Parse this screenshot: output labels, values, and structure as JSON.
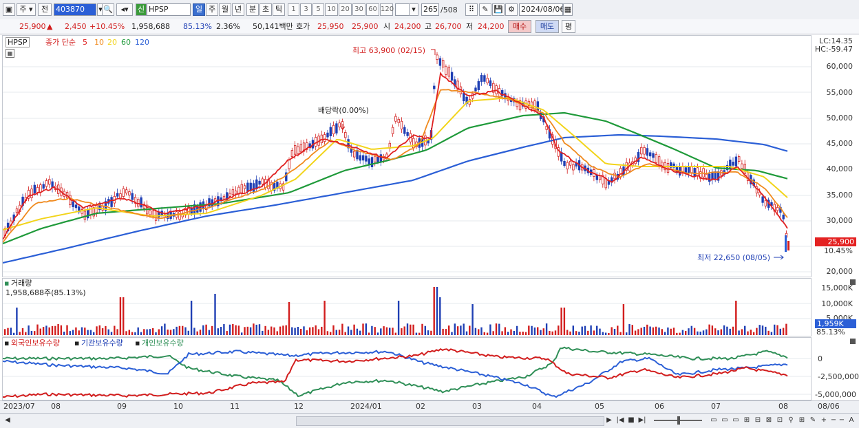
{
  "toolbar": {
    "market": "주",
    "prev": "전",
    "code": "403870",
    "flag": "신",
    "name": "HPSP",
    "periods": [
      "일",
      "주",
      "월",
      "년",
      "분",
      "초",
      "틱"
    ],
    "active_period": "일",
    "ticks": [
      "1",
      "3",
      "5",
      "10",
      "20",
      "30",
      "60",
      "120"
    ],
    "count": "265",
    "total": "/508",
    "date": "2024/08/06"
  },
  "info": {
    "price": "25,900",
    "change": "2,450",
    "change_pct": "+10.45%",
    "volume": "1,958,688",
    "vol_ratio": "85.13%",
    "turnover": "2.36%",
    "amount": "50,141백만",
    "quote_label": "호가",
    "ask": "25,950",
    "bid": "25,900",
    "open_label": "시",
    "open": "24,200",
    "high_label": "고",
    "high": "26,700",
    "low_label": "저",
    "low": "24,200",
    "buy": "매수",
    "sell": "매도",
    "eval": "평"
  },
  "price_panel": {
    "ticker": "HPSP",
    "legend_prefix": "종가 단순",
    "ma": [
      {
        "period": "5",
        "color": "#e02020"
      },
      {
        "period": "10",
        "color": "#f08a1e"
      },
      {
        "period": "20",
        "color": "#f2d41a"
      },
      {
        "period": "60",
        "color": "#1f9a3a"
      },
      {
        "period": "120",
        "color": "#2b5fd6"
      }
    ],
    "lc": "LC:14.35",
    "hc": "HC:-59.47",
    "high_note": "최고 63,900 (02/15)",
    "low_note": "최저 22,650 (08/05)",
    "dividend_note": "배당락(0.00%)",
    "last_price": "25,900",
    "last_change": "10.45%"
  },
  "volume_panel": {
    "title": "거래량",
    "value": "1,958,688주(85.13%)",
    "last_tag": "1,959K",
    "last_pct": "85.13%"
  },
  "holdings_panel": {
    "series": [
      {
        "name": "외국인보유수량",
        "color": "#d21d1d"
      },
      {
        "name": "기관보유수량",
        "color": "#2b5fd6"
      },
      {
        "name": "개인보유수량",
        "color": "#2f8f57"
      }
    ]
  },
  "chart_data": [
    {
      "type": "candlestick",
      "y_ticks": [
        "60,000",
        "55,000",
        "50,000",
        "45,000",
        "40,000",
        "35,000",
        "30,000",
        "25,000",
        "20,000"
      ],
      "ylim": [
        20000,
        64000
      ],
      "high": 63900,
      "low": 22650,
      "last": 25900,
      "x_ticks": [
        "2023/07",
        "08",
        "09",
        "10",
        "11",
        "12",
        "2024/01",
        "02",
        "03",
        "04",
        "05",
        "06",
        "07",
        "08",
        "08/06"
      ]
    },
    {
      "type": "bar",
      "title": "거래량",
      "y_ticks": [
        "15,000K",
        "10,000K",
        "5,000K"
      ]
    },
    {
      "type": "line",
      "y_ticks": [
        "0",
        "-2,500,000",
        "-5,000,000"
      ]
    }
  ],
  "status": {
    "scroll_icons": [
      "◀",
      "▶",
      "|◀",
      "■",
      "▶|"
    ]
  }
}
